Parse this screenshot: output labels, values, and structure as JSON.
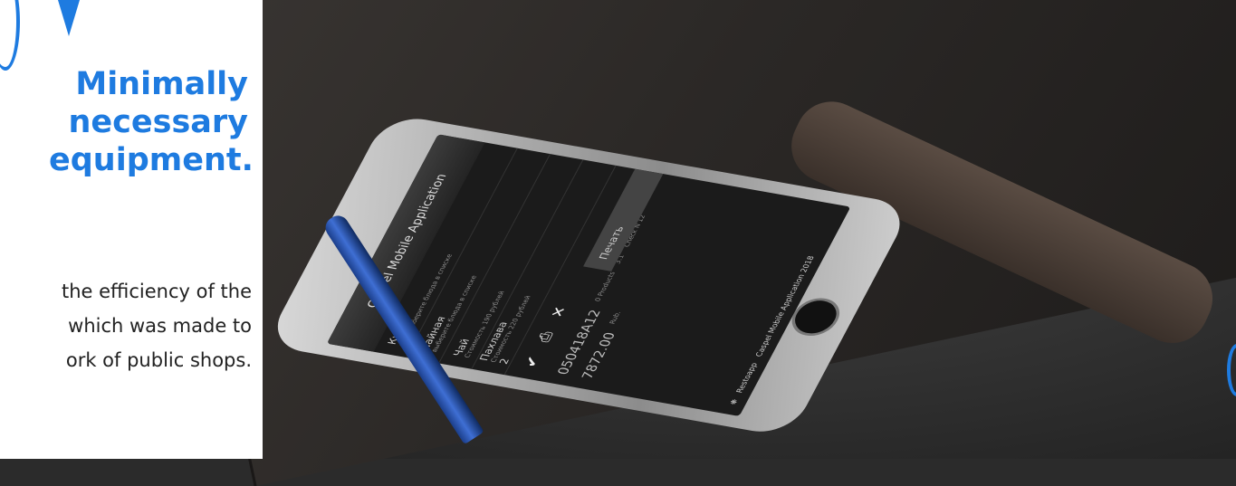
{
  "headline": [
    "Minimally",
    "necessary",
    "equipment."
  ],
  "body_lines": [
    "the efficiency of the",
    "which was made to",
    "ork of public shops."
  ],
  "phone": {
    "app_title": "Caspel Mobile Application",
    "items": [
      {
        "label": "Кухня",
        "sub": "пока выберите блюда в списке"
      },
      {
        "label": "Чайная",
        "sub": "выберите блюда в списке"
      },
      {
        "label": "Чай",
        "sub": "Стоимость 190 рублей"
      },
      {
        "label": "Пахлава",
        "sub": "Стоимость 220 рублей"
      }
    ],
    "qty": "2",
    "print_label": "Печать",
    "order_id": "050418A12",
    "products_label": "0 Products",
    "products_count": "3.1",
    "check_label": "Check N 12",
    "total": "7872.00",
    "total_unit": "Rub.",
    "brand": "Restoapp",
    "copyright": "Caspel Mobile Application 2018"
  },
  "colors": {
    "accent": "#1e7be0"
  }
}
